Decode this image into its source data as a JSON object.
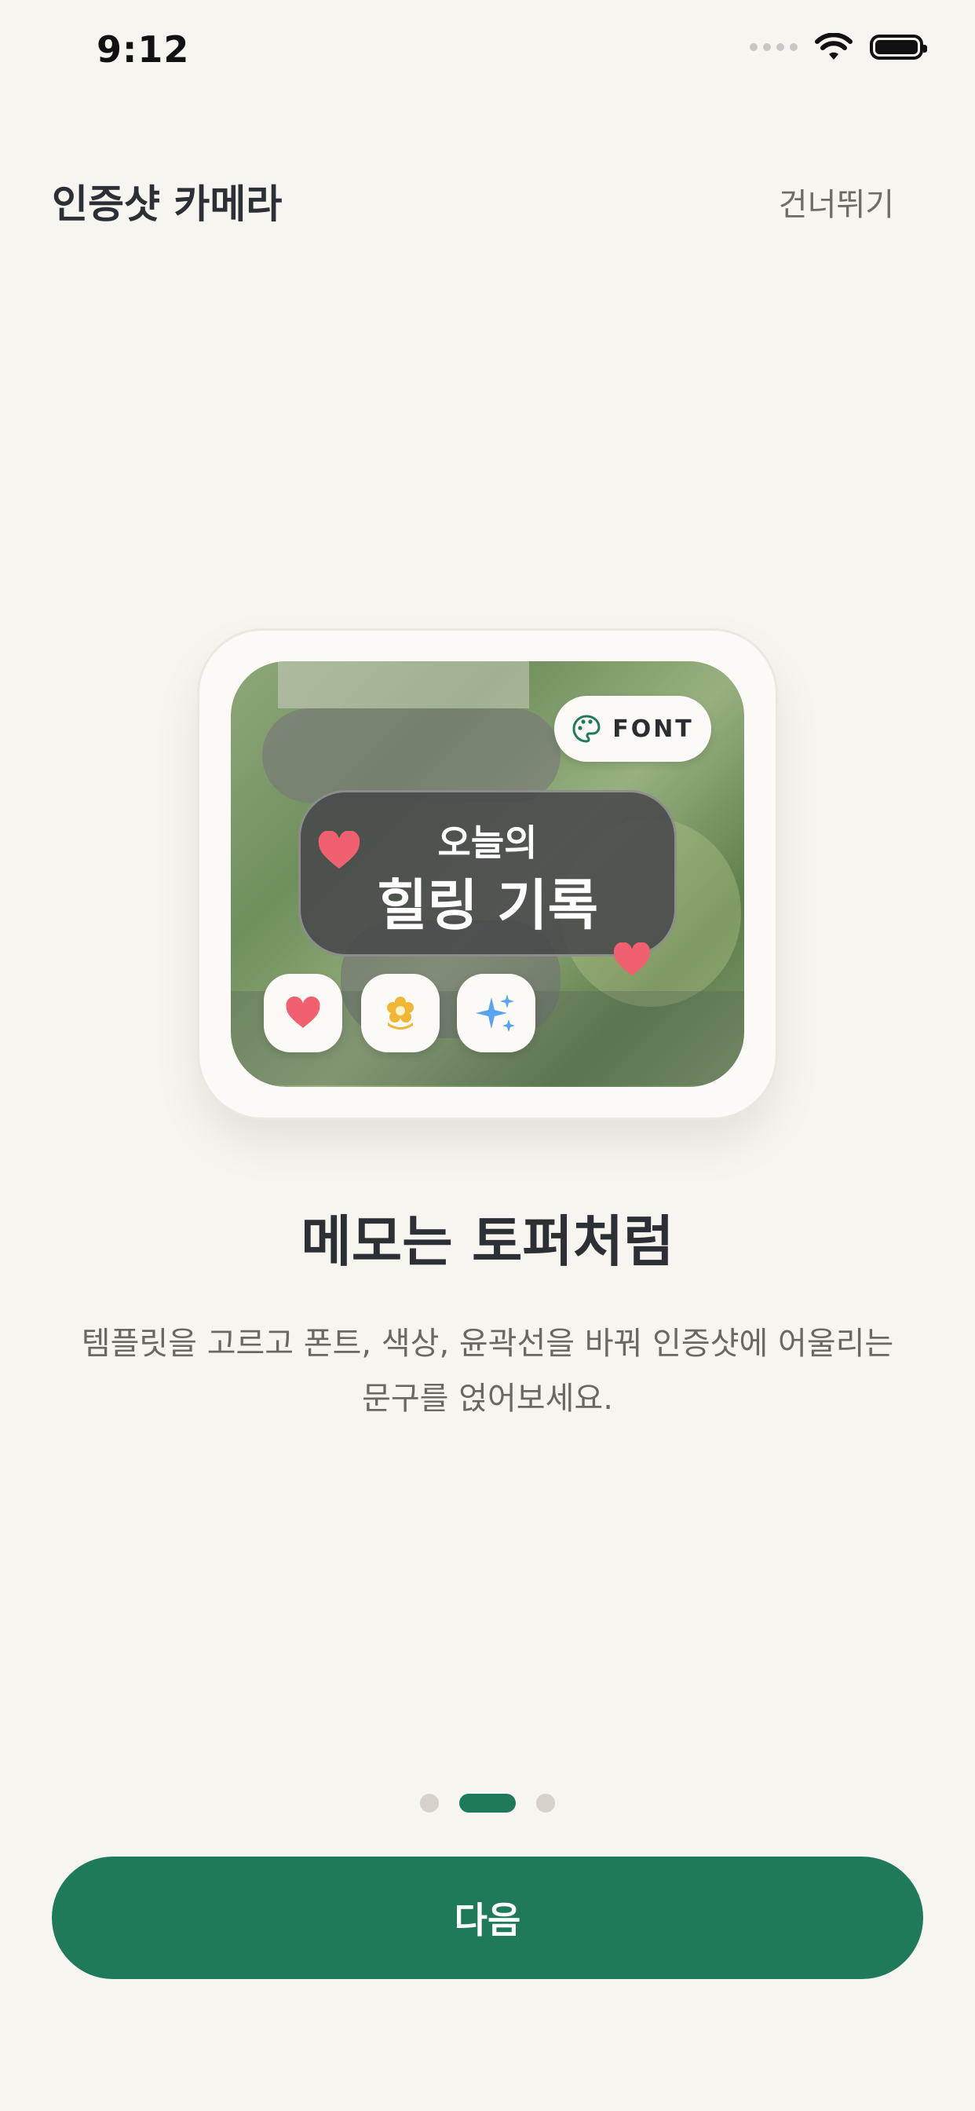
{
  "status_bar": {
    "time": "9:12"
  },
  "header": {
    "app_title": "인증샷 카메라",
    "skip_label": "건너뛰기"
  },
  "preview": {
    "font_chip_label": "FONT",
    "memo_line1": "오늘의",
    "memo_line2": "힐링 기록",
    "sticker_buttons": [
      "heart-icon",
      "flower-icon",
      "sparkle-icon"
    ]
  },
  "onboarding": {
    "headline": "메모는 토퍼처럼",
    "description": "템플릿을 고르고 폰트, 색상, 윤곽선을 바꿔 인증샷에 어울리는 문구를 얹어보세요."
  },
  "pager": {
    "total": 3,
    "current": 2
  },
  "next_button_label": "다음",
  "colors": {
    "accent": "#1f7a5a",
    "background": "#f7f5f0",
    "heart": "#f0606e",
    "flower": "#f2b635",
    "sparkle": "#5aa3f0"
  }
}
